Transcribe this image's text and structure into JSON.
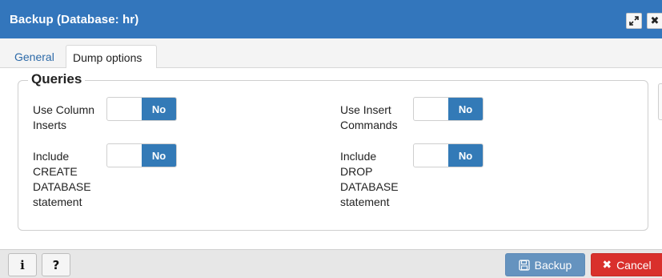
{
  "dialog": {
    "title": "Backup (Database: hr)",
    "maximize_icon": "expand-icon",
    "close_icon": "close-icon"
  },
  "tabs": [
    {
      "label": "General",
      "active": false
    },
    {
      "label": "Dump options",
      "active": true
    }
  ],
  "queries": {
    "legend": "Queries",
    "options": [
      {
        "label": "Use Column Inserts",
        "value": "No"
      },
      {
        "label": "Use Insert Commands",
        "value": "No"
      },
      {
        "label": "Include CREATE DATABASE statement",
        "value": "No"
      },
      {
        "label": "Include DROP DATABASE statement",
        "value": "No"
      }
    ]
  },
  "footer": {
    "info_label": "i",
    "help_label": "?",
    "backup_label": "Backup",
    "cancel_label": "Cancel",
    "backup_icon": "save-icon",
    "cancel_icon": "x-icon"
  },
  "colors": {
    "titlebar": "#3376bc",
    "toggle_active": "#337ab7",
    "backup_button": "#5f8fbd",
    "cancel_button": "#d9302c",
    "tab_link": "#2c6aa8"
  }
}
